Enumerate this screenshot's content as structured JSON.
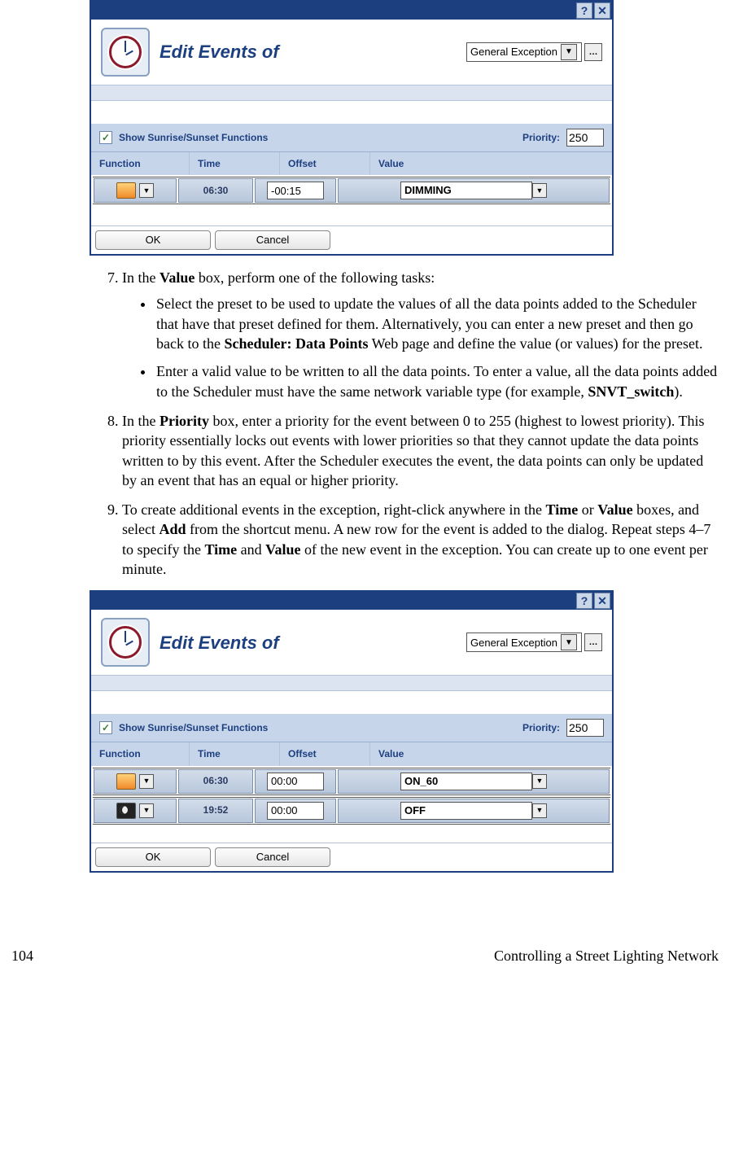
{
  "dialog1": {
    "title": "Edit Events of",
    "exception_label": "General Exception",
    "show_label": "Show Sunrise/Sunset Functions",
    "priority_label": "Priority:",
    "priority_value": "250",
    "headers": {
      "fn": "Function",
      "tm": "Time",
      "off": "Offset",
      "val": "Value"
    },
    "rows": [
      {
        "icon": "sun",
        "time": "06:30",
        "offset": "-00:15",
        "value": "DIMMING"
      }
    ],
    "ok": "OK",
    "cancel": "Cancel"
  },
  "step7": {
    "num": "7.",
    "lead": "In the ",
    "bold1": "Value",
    "after": " box, perform one of the following tasks:",
    "b1a": "Select the preset to be used to update the values of all the data points added to the Scheduler that have that preset defined for them. Alternatively, you can enter a new preset and then go back to the ",
    "b1bold": "Scheduler: Data Points",
    "b1b": " Web page and define the value (or values) for the preset.",
    "b2a": "Enter a valid value to be written to all the data points.  To enter a value, all the data points added to the Scheduler must have the same network variable type (for example, ",
    "b2bold": "SNVT_switch",
    "b2b": ")."
  },
  "step8": {
    "num": "8.",
    "a": "In the ",
    "bold": "Priority",
    "b": " box, enter a priority for the event between 0 to 255 (highest to lowest priority).  This priority essentially locks out events with lower priorities so that they cannot update the data points written to by this event.  After the Scheduler executes the event, the data points can only be updated by an event that has an equal or higher priority."
  },
  "step9": {
    "num": "9.",
    "a": "To create additional events in the exception, right-click anywhere in the ",
    "b1": "Time",
    "b": " or ",
    "b2": "Value",
    "c": " boxes, and select ",
    "b3": "Add",
    "d": " from the shortcut menu.  A new row for the event is added to the dialog.  Repeat steps 4–7 to specify the ",
    "b4": "Time",
    "e": " and ",
    "b5": "Value",
    "f": " of the new event in the exception.  You can create up to one event per minute."
  },
  "dialog2": {
    "title": "Edit Events of",
    "exception_label": "General Exception",
    "show_label": "Show Sunrise/Sunset Functions",
    "priority_label": "Priority:",
    "priority_value": "250",
    "headers": {
      "fn": "Function",
      "tm": "Time",
      "off": "Offset",
      "val": "Value"
    },
    "rows": [
      {
        "icon": "sun",
        "time": "06:30",
        "offset": "00:00",
        "value": "ON_60"
      },
      {
        "icon": "moon",
        "time": "19:52",
        "offset": "00:00",
        "value": "OFF"
      }
    ],
    "ok": "OK",
    "cancel": "Cancel"
  },
  "footer": {
    "page": "104",
    "title": "Controlling a Street Lighting Network"
  }
}
